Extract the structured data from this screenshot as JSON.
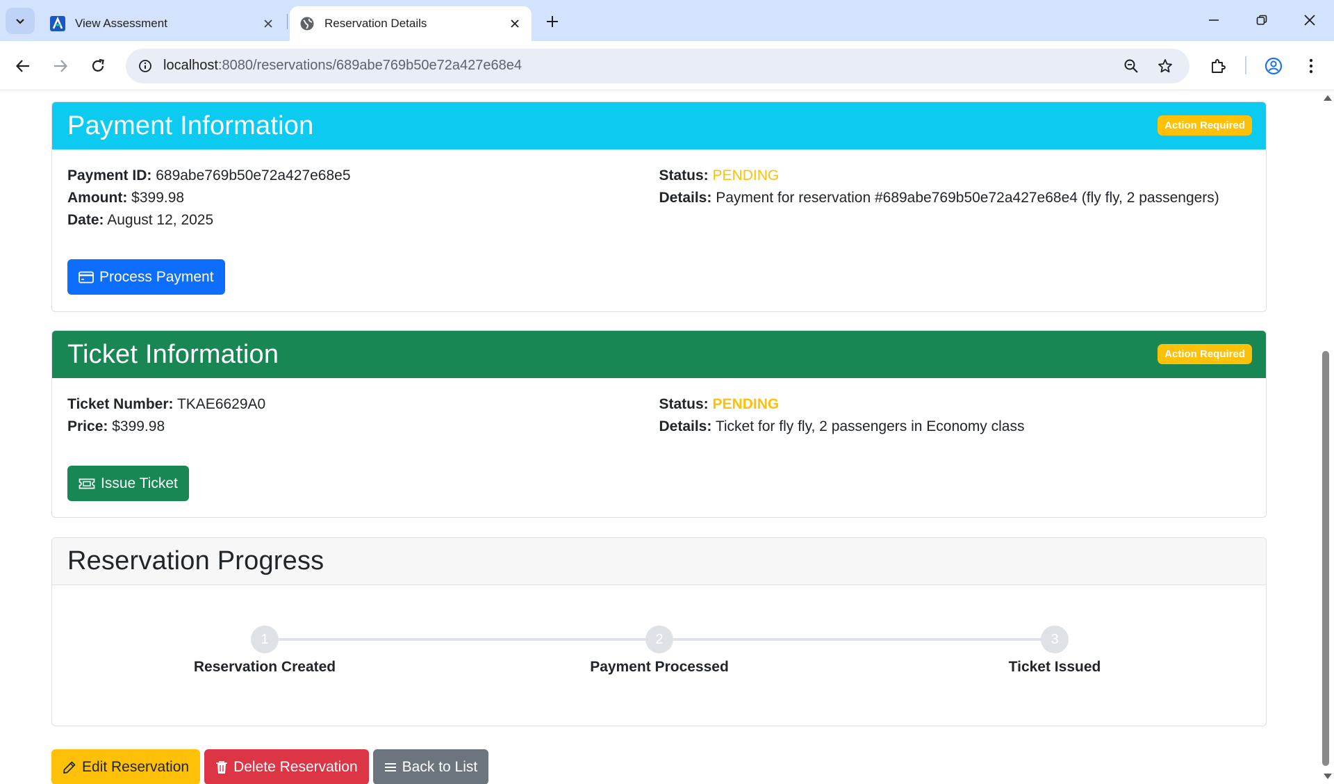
{
  "browser": {
    "tabs": [
      {
        "title": "View Assessment",
        "active": false,
        "icon": "assessment-app-icon"
      },
      {
        "title": "Reservation Details",
        "active": true,
        "icon": "globe-icon"
      }
    ],
    "url_host": "localhost",
    "url_path": ":8080/reservations/689abe769b50e72a427e68e4"
  },
  "payment": {
    "title": "Payment Information",
    "badge": "Action Required",
    "id_label": "Payment ID:",
    "id_value": "689abe769b50e72a427e68e5",
    "amount_label": "Amount:",
    "amount_value": "$399.98",
    "date_label": "Date:",
    "date_value": "August 12, 2025",
    "status_label": "Status:",
    "status_value": "PENDING",
    "details_label": "Details:",
    "details_value": "Payment for reservation #689abe769b50e72a427e68e4 (fly fly, 2 passengers)",
    "button": "Process Payment"
  },
  "ticket": {
    "title": "Ticket Information",
    "badge": "Action Required",
    "number_label": "Ticket Number:",
    "number_value": "TKAE6629A0",
    "price_label": "Price:",
    "price_value": "$399.98",
    "status_label": "Status:",
    "status_value": "PENDING",
    "details_label": "Details:",
    "details_value": "Ticket for fly fly, 2 passengers in Economy class",
    "button": "Issue Ticket"
  },
  "progress": {
    "title": "Reservation Progress",
    "steps": [
      {
        "number": "1",
        "label": "Reservation Created"
      },
      {
        "number": "2",
        "label": "Payment Processed"
      },
      {
        "number": "3",
        "label": "Ticket Issued"
      }
    ]
  },
  "actions": {
    "edit": "Edit Reservation",
    "delete": "Delete Reservation",
    "back": "Back to List"
  },
  "colors": {
    "info": "#0dcaf0",
    "success": "#198754",
    "warning": "#ffc107",
    "primary": "#0d6efd",
    "danger": "#dc3545",
    "secondary": "#6c757d"
  }
}
